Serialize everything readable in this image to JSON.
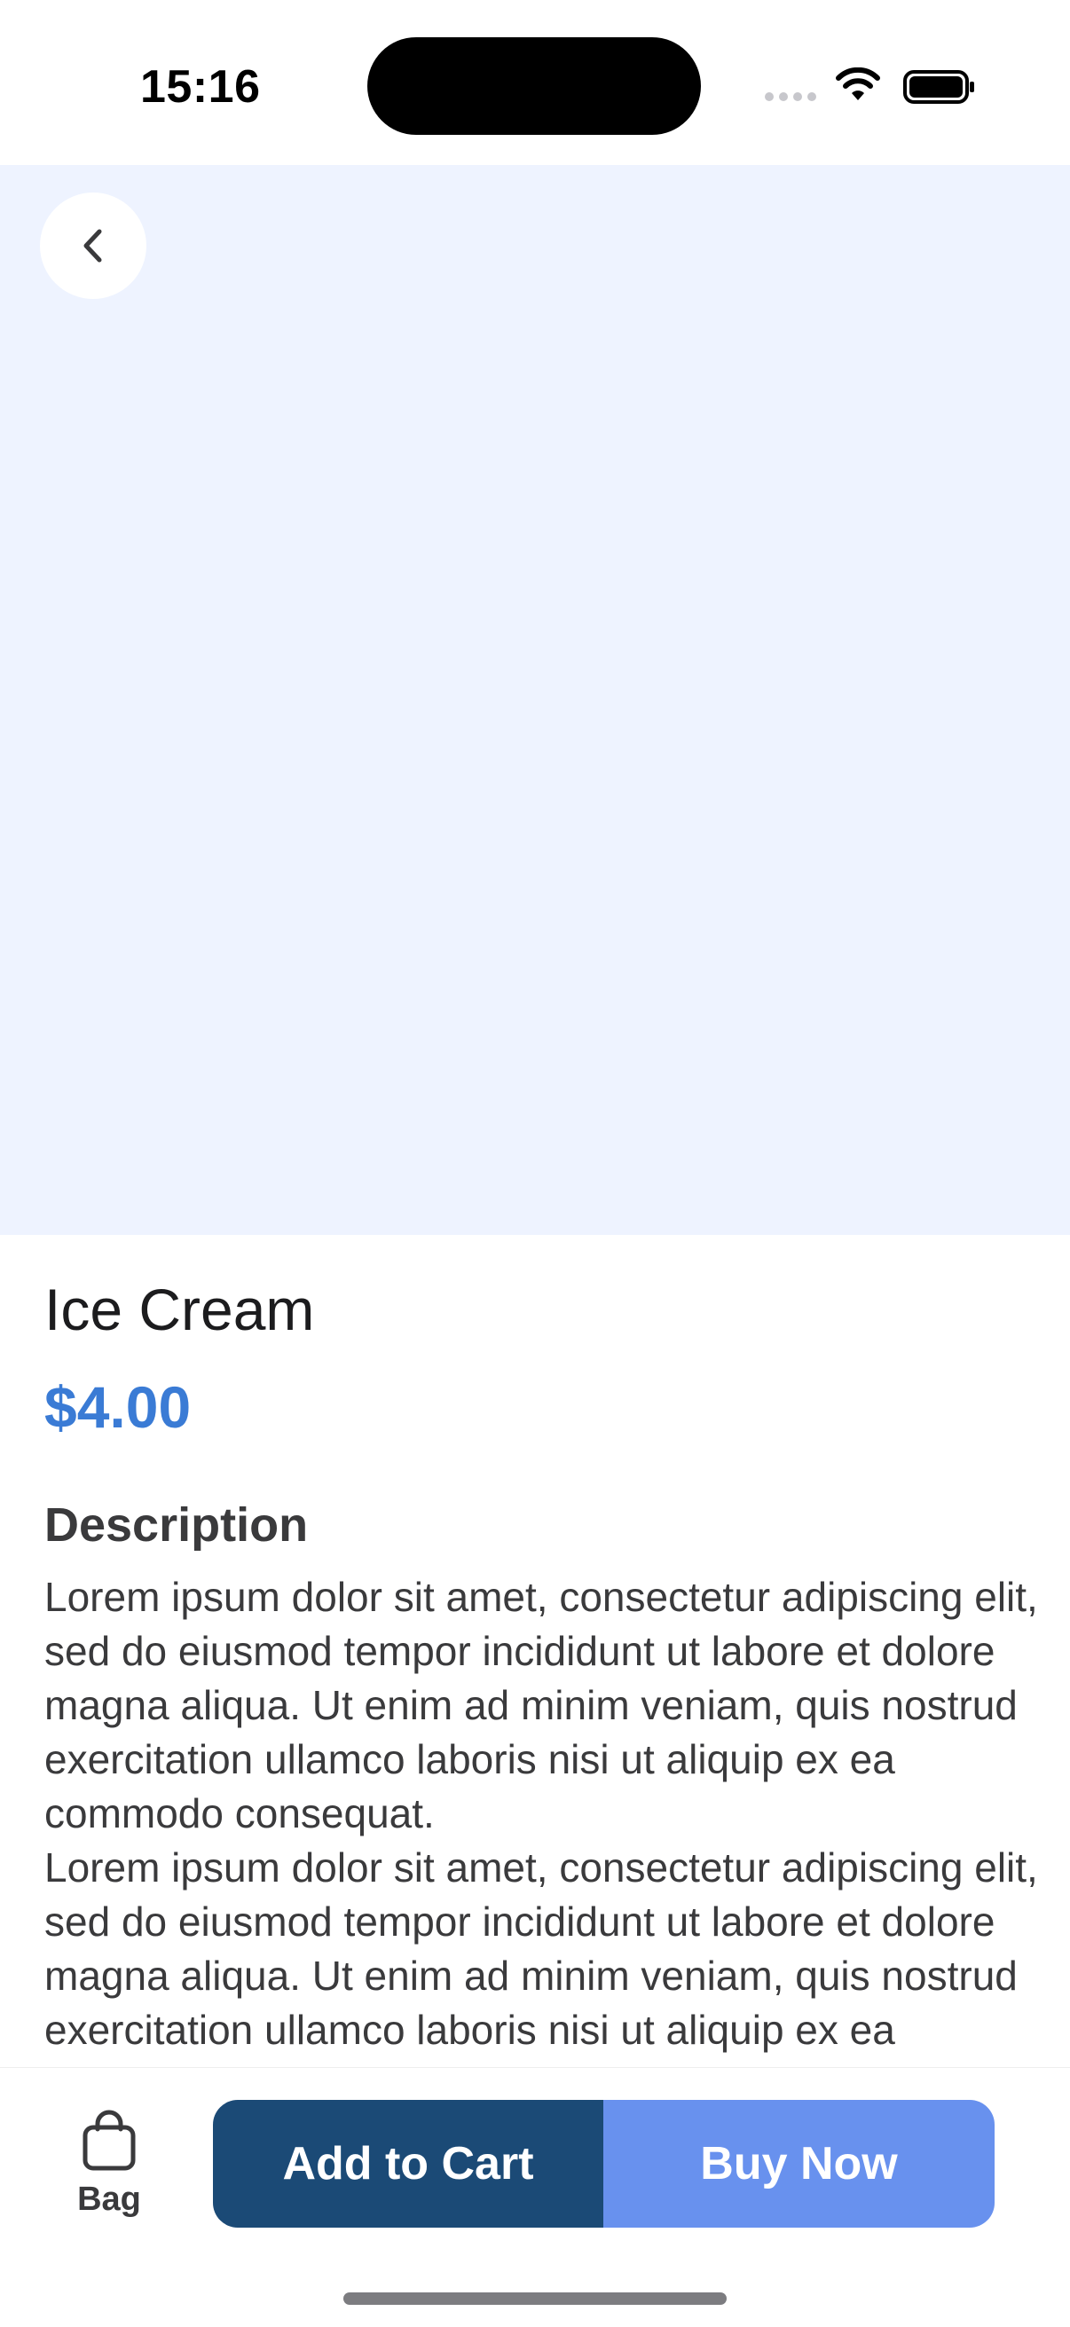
{
  "status_bar": {
    "time": "15:16"
  },
  "colors": {
    "accent": "#3a7bd5",
    "hero_background": "#eef3ff",
    "add_to_cart": "#1b4a76",
    "buy_now": "#6891ee"
  },
  "product": {
    "name": "Ice Cream",
    "price": "$4.00",
    "description_heading": "Description",
    "description": "Lorem ipsum dolor sit amet, consectetur adipiscing elit, sed do eiusmod tempor incididunt ut labore et dolore magna aliqua. Ut enim ad minim veniam, quis nostrud exercitation ullamco laboris nisi ut aliquip ex ea commodo consequat.\nLorem ipsum dolor sit amet, consectetur adipiscing elit, sed do eiusmod tempor incididunt ut labore et dolore magna aliqua. Ut enim ad minim veniam, quis nostrud exercitation ullamco laboris nisi ut aliquip ex ea commodo consequat."
  },
  "icons": {
    "back": "chevron-left-icon",
    "bag": "shopping-bag-icon"
  },
  "bottom_bar": {
    "bag_label": "Bag",
    "add_to_cart_label": "Add to Cart",
    "buy_now_label": "Buy Now"
  }
}
